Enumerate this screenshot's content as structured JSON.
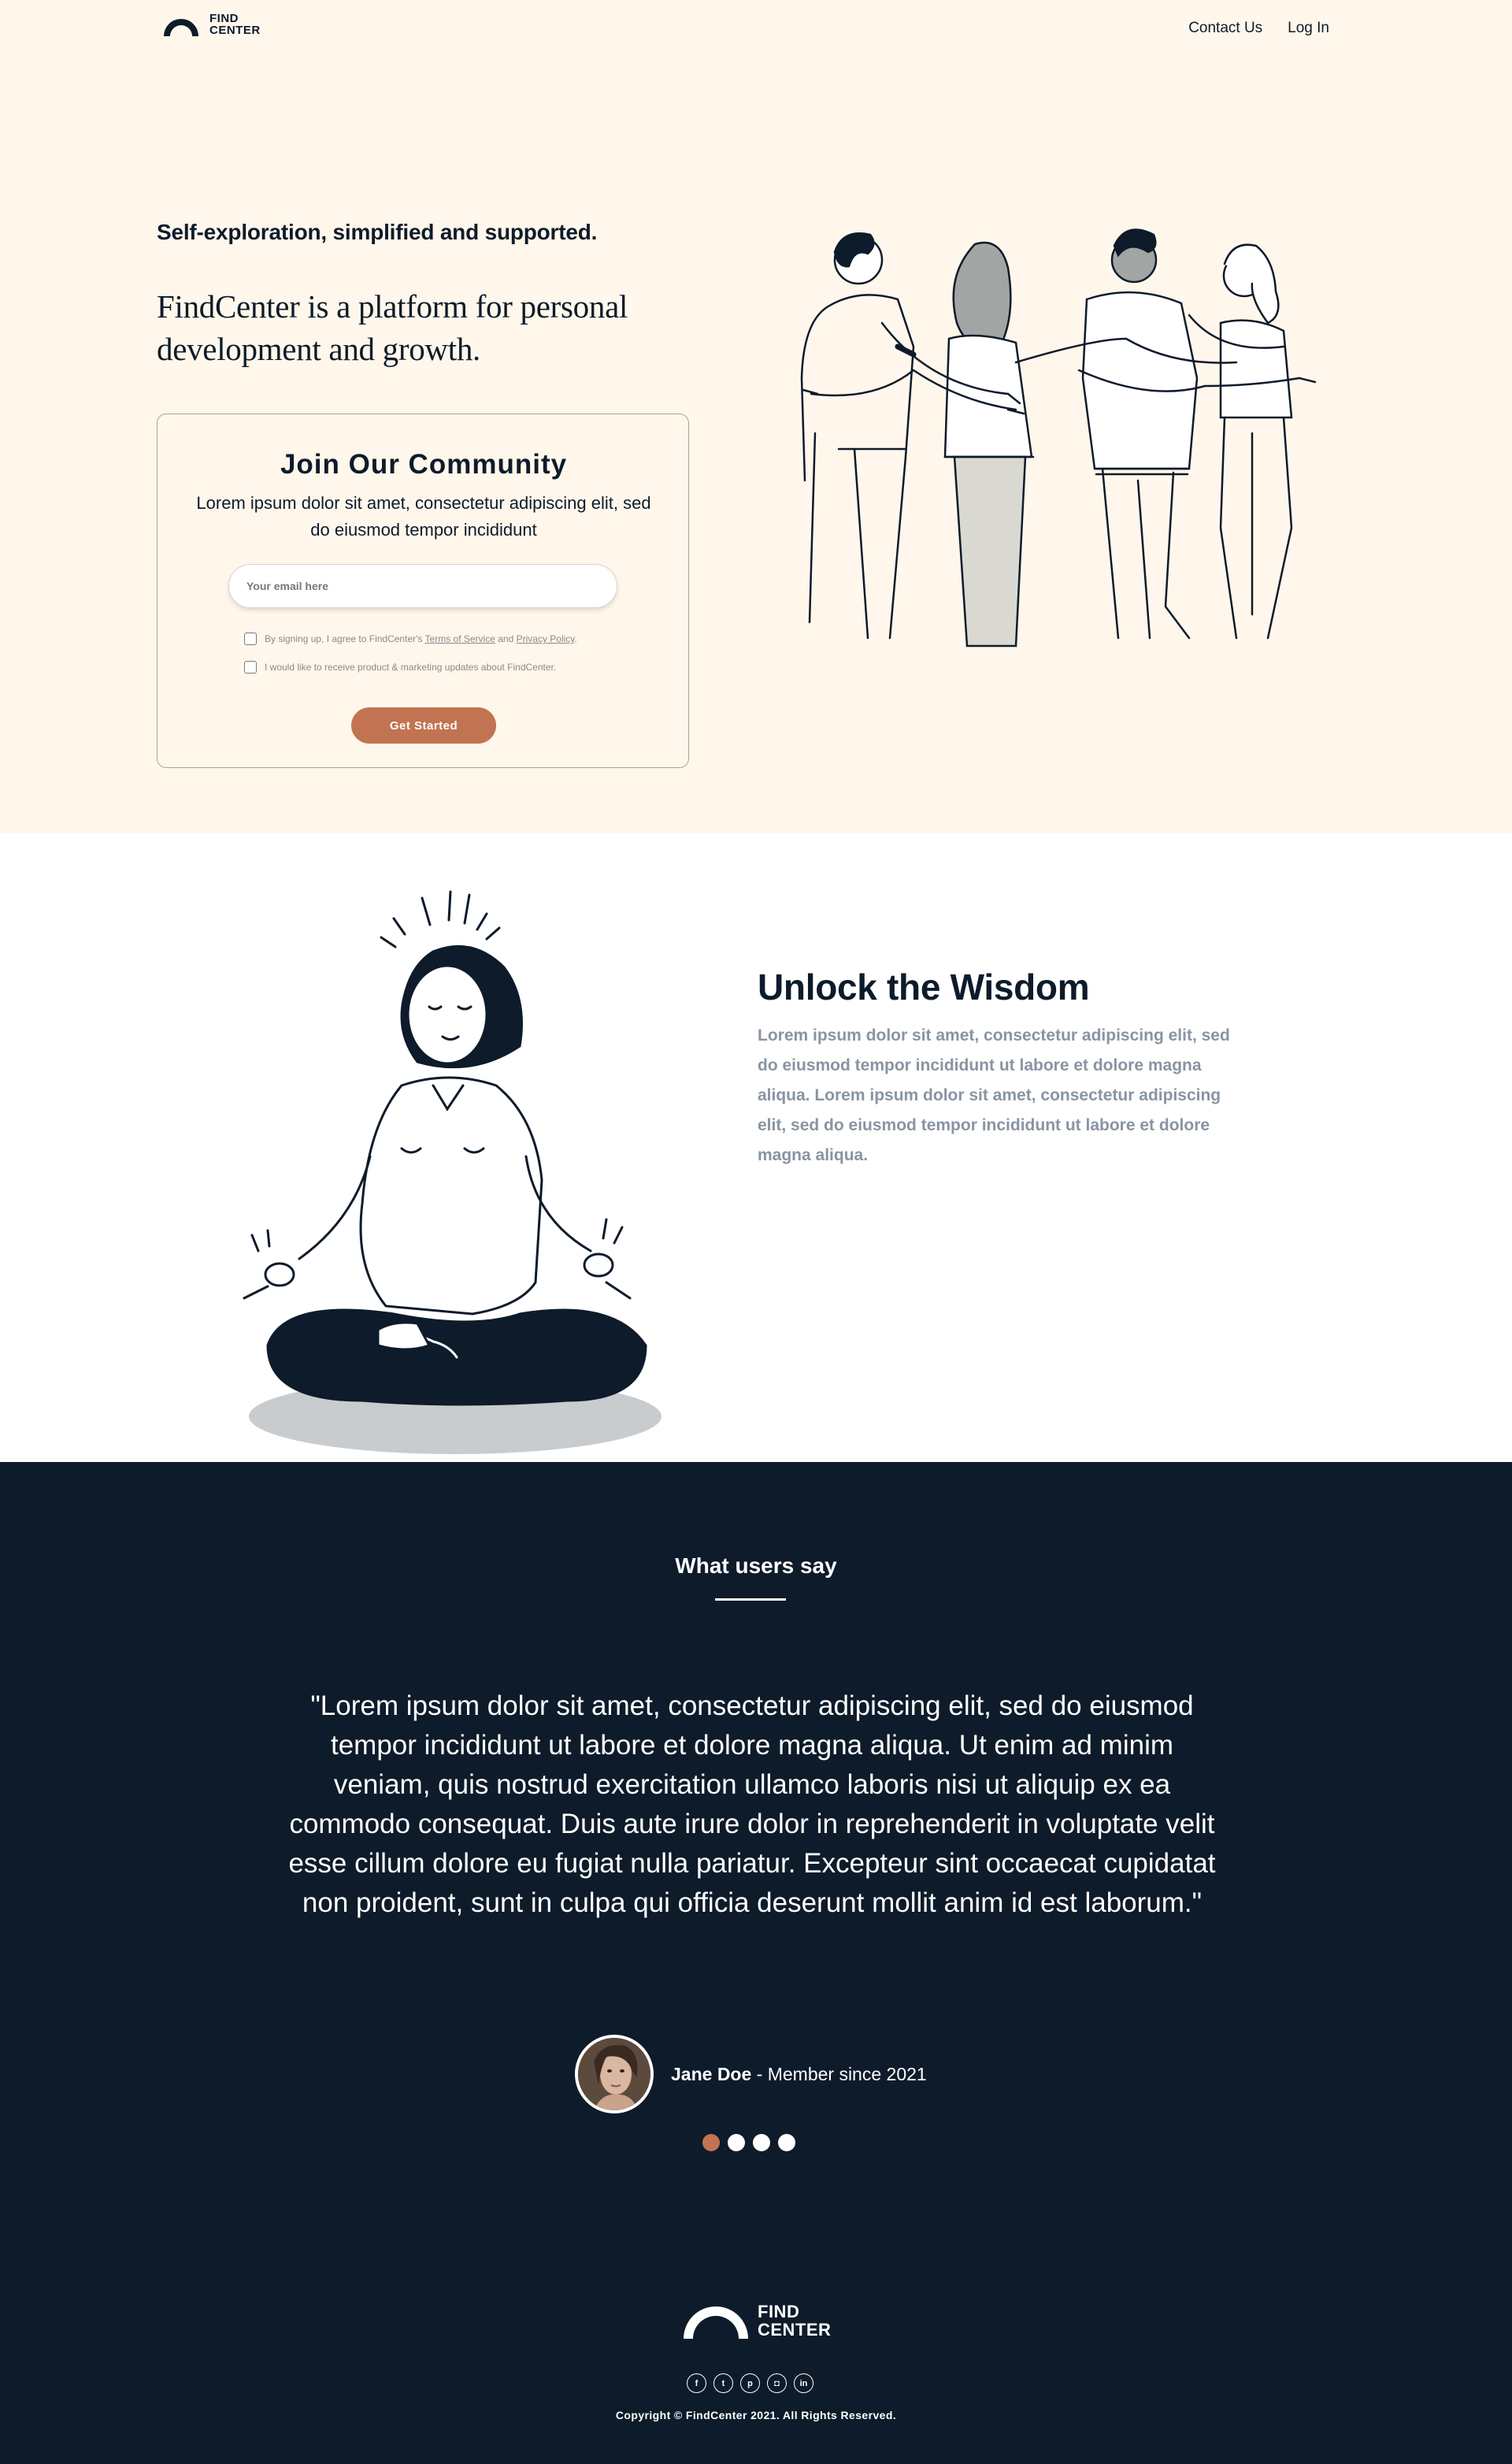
{
  "brand": {
    "line1": "FIND",
    "line2": "CENTER"
  },
  "nav": {
    "contact": "Contact Us",
    "login": "Log In"
  },
  "hero": {
    "tagline": "Self-exploration, simplified and supported.",
    "title": "FindCenter is a platform for personal development and growth."
  },
  "join": {
    "title": "Join Our Community",
    "subtitle": "Lorem ipsum dolor sit amet, consectetur adipiscing elit, sed do eiusmod tempor incididunt",
    "email_placeholder": "Your email here",
    "terms_prefix": "By signing up, I agree to FindCenter's",
    "terms_link": "Terms of Service",
    "terms_and": "and",
    "privacy_link": "Privacy Policy",
    "marketing": "I would like to receive product & marketing updates about FindCenter.",
    "cta": "Get Started"
  },
  "wisdom": {
    "title": "Unlock the Wisdom",
    "body": "Lorem ipsum dolor sit amet, consectetur adipiscing elit, sed do eiusmod tempor incididunt ut labore et dolore magna aliqua. Lorem ipsum dolor sit amet, consectetur adipiscing elit, sed do eiusmod tempor incididunt ut labore et dolore magna aliqua."
  },
  "testimonials": {
    "heading": "What users say",
    "quote": "\"Lorem ipsum dolor sit amet, consectetur adipiscing elit, sed do eiusmod tempor incididunt ut labore et dolore magna aliqua. Ut enim ad minim veniam, quis nostrud exercitation ullamco laboris nisi ut aliquip ex ea commodo consequat. Duis aute irure dolor in reprehenderit in voluptate velit esse cillum dolore eu fugiat nulla pariatur. Excepteur sint occaecat cupidatat non proident, sunt in culpa qui officia deserunt mollit anim id est laborum.\"",
    "author_name": "Jane Doe",
    "author_meta": " - Member since 2021",
    "active_dot": 1,
    "dot_count": 4
  },
  "footer": {
    "socials": [
      "facebook-icon",
      "twitter-icon",
      "pinterest-icon",
      "instagram-icon",
      "linkedin-icon"
    ],
    "copyright": "Copyright © FindCenter 2021. All Rights Reserved."
  },
  "colors": {
    "cream": "#fff7eb",
    "navy": "#0d1b2a",
    "accent": "#c27352",
    "muted": "#8994a2"
  }
}
